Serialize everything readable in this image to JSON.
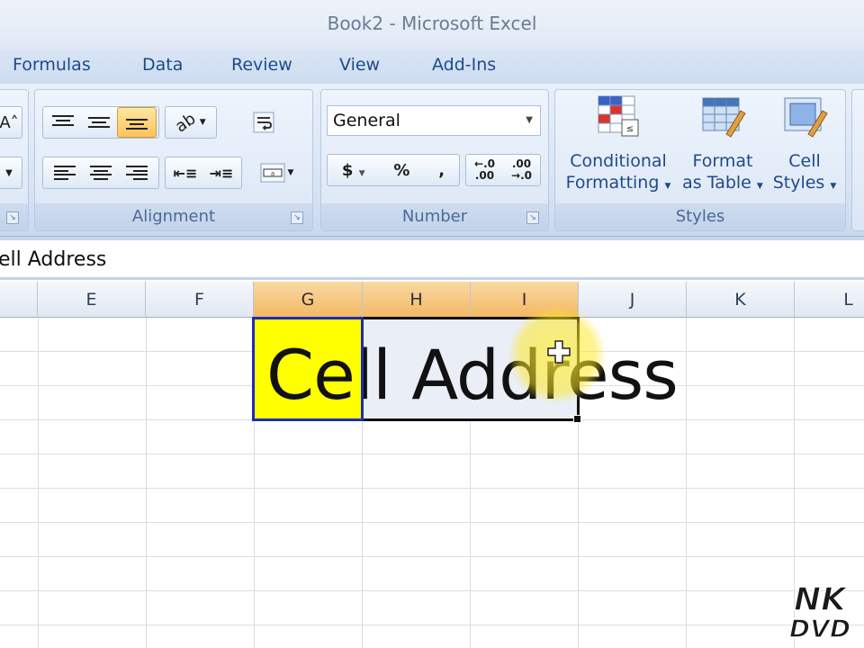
{
  "window": {
    "title": "Book2 - Microsoft Excel"
  },
  "tabs": [
    {
      "label": "Formulas"
    },
    {
      "label": "Data"
    },
    {
      "label": "Review"
    },
    {
      "label": "View"
    },
    {
      "label": "Add-Ins"
    }
  ],
  "ribbon": {
    "alignment": {
      "label": "Alignment",
      "wrap_icon": "wrap-text-icon",
      "merge_icon": "merge-center-icon",
      "orientation_icon": "orientation-icon"
    },
    "number": {
      "label": "Number",
      "format_value": "General",
      "currency_symbol": "$",
      "percent_symbol": "%",
      "comma_symbol": ",",
      "increase_decimal_label": "←.0 .00",
      "decrease_decimal_label": ".00 →.0"
    },
    "styles": {
      "label": "Styles",
      "conditional_line1": "Conditional",
      "conditional_line2": "Formatting",
      "format_table_line1": "Format",
      "format_table_line2": "as Table",
      "cell_styles_line1": "Cell",
      "cell_styles_line2": "Styles"
    }
  },
  "formula_bar": {
    "value": "ell Address"
  },
  "columns": [
    "E",
    "F",
    "G",
    "H",
    "I",
    "J",
    "K",
    "L"
  ],
  "selected_columns": [
    "G",
    "H",
    "I"
  ],
  "cell": {
    "text": "Cell Address",
    "fill_color": "#ffff00"
  },
  "colors": {
    "accent": "#1f4a8a",
    "selection_header": "#f2b763",
    "active_border": "#1b2db5"
  },
  "watermark": {
    "line1": "NK",
    "line2": "DVD"
  }
}
